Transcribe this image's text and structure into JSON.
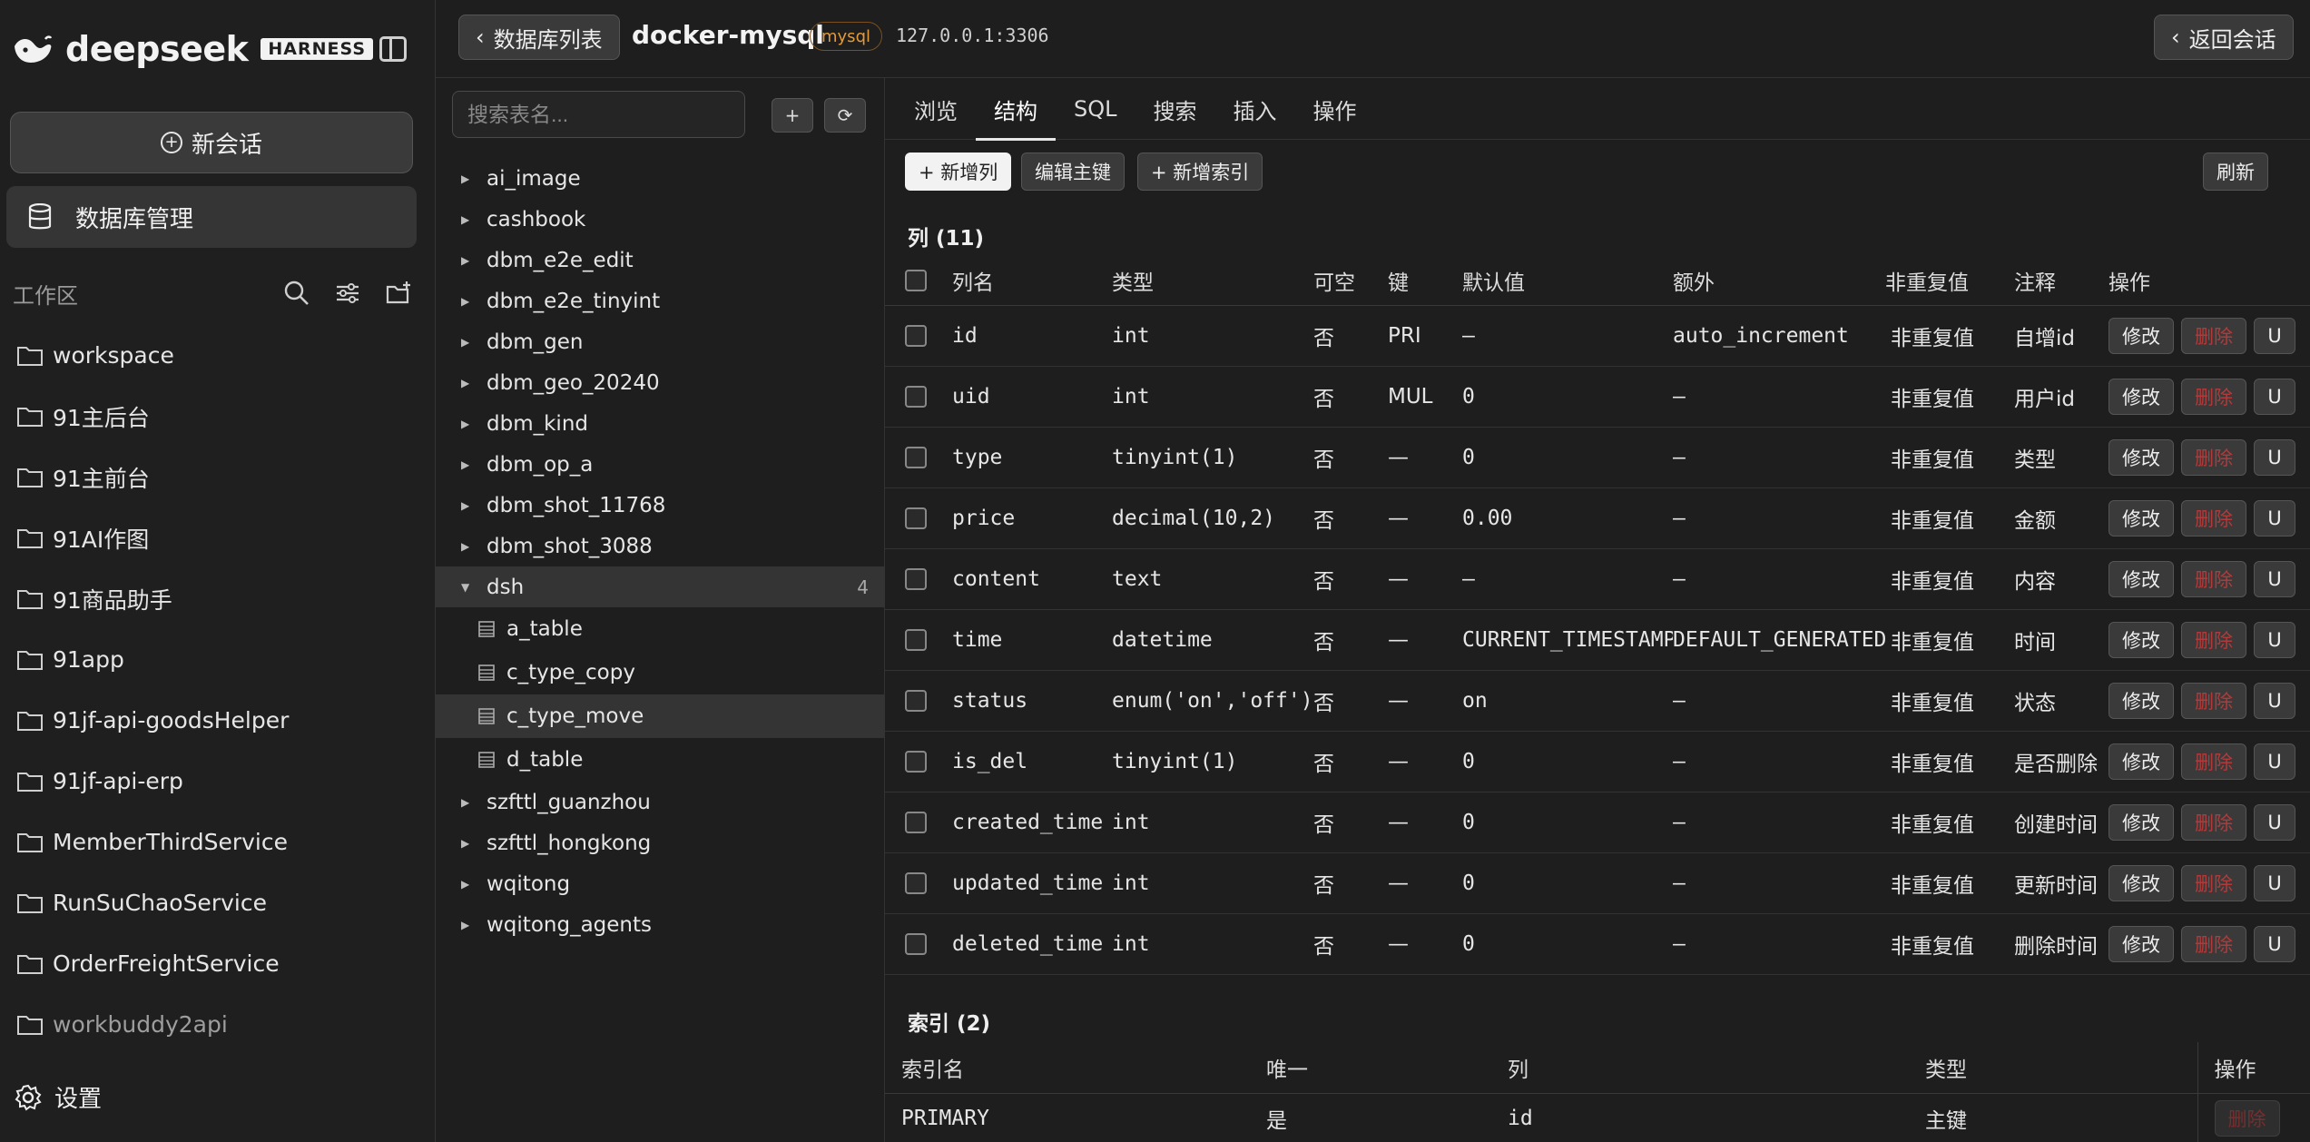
{
  "sidebar": {
    "logo_text": "deepseek",
    "logo_badge": "HARNESS",
    "new_chat_label": "新会话",
    "db_mgmt_label": "数据库管理",
    "workspace_title": "工作区",
    "workspace_items": [
      {
        "label": "workspace"
      },
      {
        "label": "91主后台"
      },
      {
        "label": "91主前台"
      },
      {
        "label": "91AI作图"
      },
      {
        "label": "91商品助手"
      },
      {
        "label": "91app"
      },
      {
        "label": "91jf-api-goodsHelper"
      },
      {
        "label": "91jf-api-erp"
      },
      {
        "label": "MemberThirdService"
      },
      {
        "label": "RunSuChaoService"
      },
      {
        "label": "OrderFreightService"
      },
      {
        "label": "workbuddy2api"
      }
    ],
    "settings_label": "设置"
  },
  "topbar": {
    "back_label": "数据库列表",
    "connection_name": "docker-mysql",
    "db_type_badge": "mysql",
    "host": "127.0.0.1:3306",
    "return_label": "返回会话"
  },
  "tree": {
    "search_placeholder": "搜索表名...",
    "add_label": "+",
    "refresh_label": "⟳",
    "databases_before": [
      "ai_image",
      "cashbook",
      "dbm_e2e_edit",
      "dbm_e2e_tinyint",
      "dbm_gen",
      "dbm_geo_20240",
      "dbm_kind",
      "dbm_op_a",
      "dbm_shot_11768",
      "dbm_shot_3088"
    ],
    "open_db": {
      "name": "dsh",
      "count": "4",
      "tables": [
        "a_table",
        "c_type_copy",
        "c_type_move",
        "d_table"
      ],
      "active_table": "c_type_move"
    },
    "databases_after": [
      "szfttl_guanzhou",
      "szfttl_hongkong",
      "wqitong",
      "wqitong_agents"
    ]
  },
  "main": {
    "tabs": [
      "浏览",
      "结构",
      "SQL",
      "搜索",
      "插入",
      "操作"
    ],
    "active_tab": "结构",
    "toolbar": {
      "add_column": "+ 新增列",
      "edit_pk": "编辑主键",
      "add_index": "+ 新增索引",
      "refresh": "刷新"
    },
    "columns_title": "列 (11)",
    "columns_headers": [
      "列名",
      "类型",
      "可空",
      "键",
      "默认值",
      "额外",
      "非重复值",
      "注释",
      "操作"
    ],
    "columns": [
      {
        "name": "id",
        "type": "int",
        "nullable": "否",
        "key": "PRI",
        "default": "–",
        "extra": "auto_increment",
        "distinct": "非重复值",
        "comment": "自增id"
      },
      {
        "name": "uid",
        "type": "int",
        "nullable": "否",
        "key": "MUL",
        "default": "0",
        "extra": "–",
        "distinct": "非重复值",
        "comment": "用户id"
      },
      {
        "name": "type",
        "type": "tinyint(1)",
        "nullable": "否",
        "key": "—",
        "default": "0",
        "extra": "–",
        "distinct": "非重复值",
        "comment": "类型"
      },
      {
        "name": "price",
        "type": "decimal(10,2)",
        "nullable": "否",
        "key": "—",
        "default": "0.00",
        "extra": "–",
        "distinct": "非重复值",
        "comment": "金额"
      },
      {
        "name": "content",
        "type": "text",
        "nullable": "否",
        "key": "—",
        "default": "–",
        "extra": "–",
        "distinct": "非重复值",
        "comment": "内容"
      },
      {
        "name": "time",
        "type": "datetime",
        "nullable": "否",
        "key": "—",
        "default": "CURRENT_TIMESTAMP",
        "extra": "DEFAULT_GENERATED",
        "distinct": "非重复值",
        "comment": "时间"
      },
      {
        "name": "status",
        "type": "enum('on','off')",
        "nullable": "否",
        "key": "—",
        "default": "on",
        "extra": "–",
        "distinct": "非重复值",
        "comment": "状态"
      },
      {
        "name": "is_del",
        "type": "tinyint(1)",
        "nullable": "否",
        "key": "—",
        "default": "0",
        "extra": "–",
        "distinct": "非重复值",
        "comment": "是否删除"
      },
      {
        "name": "created_time",
        "type": "int",
        "nullable": "否",
        "key": "—",
        "default": "0",
        "extra": "–",
        "distinct": "非重复值",
        "comment": "创建时间"
      },
      {
        "name": "updated_time",
        "type": "int",
        "nullable": "否",
        "key": "—",
        "default": "0",
        "extra": "–",
        "distinct": "非重复值",
        "comment": "更新时间"
      },
      {
        "name": "deleted_time",
        "type": "int",
        "nullable": "否",
        "key": "—",
        "default": "0",
        "extra": "–",
        "distinct": "非重复值",
        "comment": "删除时间"
      }
    ],
    "row_actions": {
      "edit": "修改",
      "delete": "删除",
      "unique": "U"
    },
    "indexes_title": "索引 (2)",
    "indexes_headers": [
      "索引名",
      "唯一",
      "列",
      "类型",
      "操作"
    ],
    "indexes": [
      {
        "name": "PRIMARY",
        "unique": "是",
        "column": "id",
        "type": "主键",
        "action": "删除"
      }
    ]
  },
  "colors": {
    "accent_danger": "#b33a3a",
    "badge_orange": "#e39a3a",
    "bg": "#1e1e1e"
  }
}
